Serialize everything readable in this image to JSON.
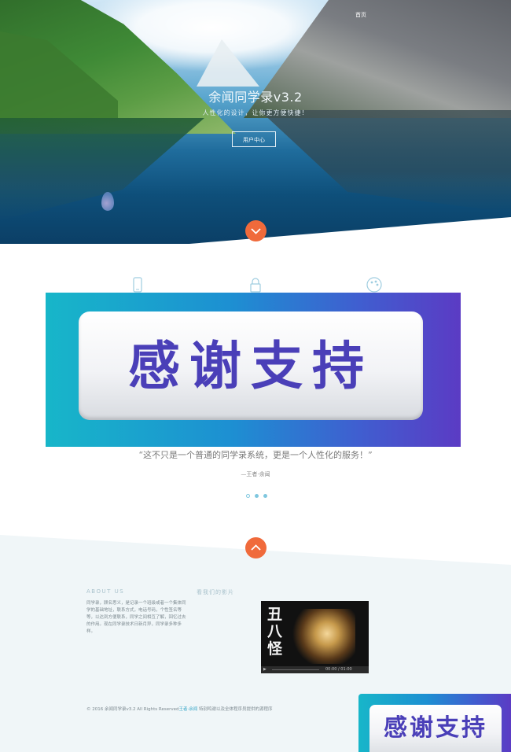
{
  "nav": {
    "home": "首页"
  },
  "hero": {
    "title": "余闻同学录v3.2",
    "subtitle": "人性化的设计，让你更方便快捷！",
    "button": "用户中心"
  },
  "icons": {
    "scroll_down": "chevron-down-icon",
    "scroll_up": "chevron-up-icon",
    "features": [
      "phone-icon",
      "lock-icon",
      "palette-icon"
    ]
  },
  "banner": {
    "text": "感谢支持"
  },
  "testimonial": {
    "quote": "“这不只是一个普通的同学录系统，更是一个人性化的服务！”",
    "author": "—王者·余闻"
  },
  "footer": {
    "about_heading": "ABOUT US",
    "about_text": "同学录，顾名思义，是记录一个班级或者一个集体同学的基础地址，联系方式，电话号码，个性签名等等，以达到方便联系，同学之间相互了解，回忆过去的作用。现在同学录技术日新月异，同学录多种多样。",
    "video_heading": "看我们的影片",
    "video_title": "丑八怪",
    "video_time": "00:00 / 01:00",
    "copyright_prefix": "© 2016 余闻同学录v3.2 All Rights Reserved",
    "copyright_link": "王者·余闻",
    "copyright_suffix": " 特别鸣谢以及全体程序员提供的源程序"
  },
  "badge": {
    "text": "感谢支持"
  },
  "colors": {
    "accent": "#f06a3b",
    "banner_text": "#4a3fb8",
    "link": "#3aa7c8"
  }
}
